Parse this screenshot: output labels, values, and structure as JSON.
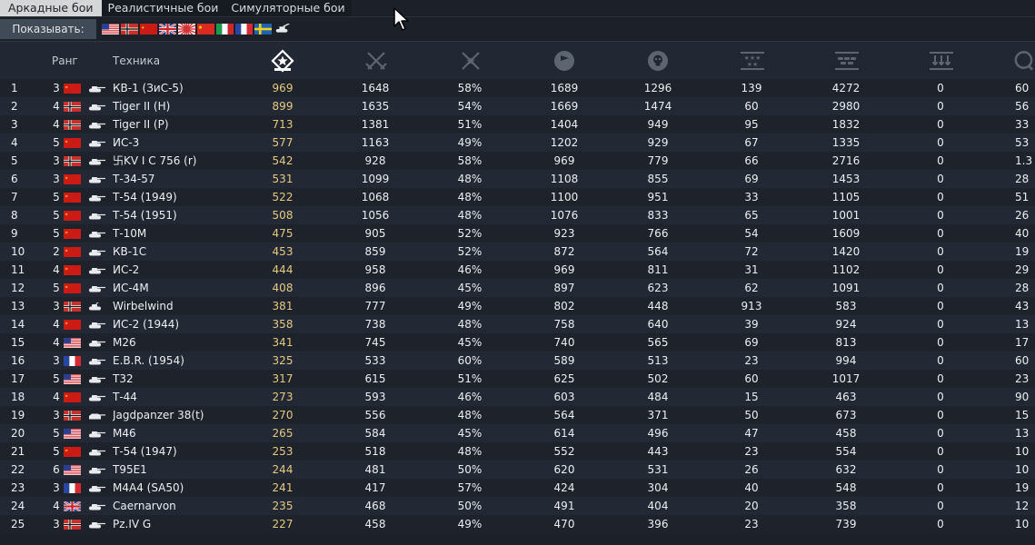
{
  "tabs": [
    {
      "label": "Аркадные бои",
      "active": true
    },
    {
      "label": "Реалистичные бои",
      "active": false
    },
    {
      "label": "Симуляторные бои",
      "active": false
    }
  ],
  "filter": {
    "show_label": "Показывать:",
    "nations": [
      "usa",
      "germany",
      "ussr",
      "britain",
      "japan",
      "china",
      "italy",
      "france",
      "sweden"
    ]
  },
  "columns": {
    "rank": "Ранг",
    "vehicle": "Техника",
    "icons": [
      "score-icon",
      "battles-icon",
      "winrate-icon",
      "respawns-icon",
      "deaths-icon",
      "air-kills-icon",
      "ground-kills-icon",
      "naval-kills-icon",
      "kd-ratio-icon"
    ]
  },
  "colors": {
    "ussr": "#cc1a14",
    "usa": "#ffffff",
    "germany": "#c9302c",
    "britain": "#1f3f8c",
    "france": "#1f3f8c",
    "score": "#e6c980",
    "tab_active": "#d4d6d8"
  },
  "rows": [
    {
      "n": "1",
      "rank": "3",
      "nation": "ussr",
      "type": "heavy",
      "name": "КВ-1 (ЗиС-5)",
      "score": "969",
      "battles": "1648",
      "win": "58%",
      "respawns": "1689",
      "deaths": "1296",
      "air": "139",
      "ground": "4272",
      "naval": "0",
      "last": "60"
    },
    {
      "n": "2",
      "rank": "4",
      "nation": "germany",
      "type": "heavy",
      "name": "Tiger II (H)",
      "score": "899",
      "battles": "1635",
      "win": "54%",
      "respawns": "1669",
      "deaths": "1474",
      "air": "60",
      "ground": "2980",
      "naval": "0",
      "last": "56"
    },
    {
      "n": "3",
      "rank": "4",
      "nation": "germany",
      "type": "heavy",
      "name": "Tiger II (P)",
      "score": "713",
      "battles": "1381",
      "win": "51%",
      "respawns": "1404",
      "deaths": "949",
      "air": "95",
      "ground": "1832",
      "naval": "0",
      "last": "33"
    },
    {
      "n": "4",
      "rank": "5",
      "nation": "ussr",
      "type": "heavy",
      "name": "ИС-3",
      "score": "577",
      "battles": "1163",
      "win": "49%",
      "respawns": "1202",
      "deaths": "929",
      "air": "67",
      "ground": "1335",
      "naval": "0",
      "last": "53"
    },
    {
      "n": "5",
      "rank": "3",
      "nation": "germany",
      "type": "heavy",
      "name": "卐KV I C 756 (r)",
      "score": "542",
      "battles": "928",
      "win": "58%",
      "respawns": "969",
      "deaths": "779",
      "air": "66",
      "ground": "2716",
      "naval": "0",
      "last": "1.3"
    },
    {
      "n": "6",
      "rank": "3",
      "nation": "ussr",
      "type": "medium",
      "name": "Т-34-57",
      "score": "531",
      "battles": "1099",
      "win": "48%",
      "respawns": "1108",
      "deaths": "855",
      "air": "69",
      "ground": "1453",
      "naval": "0",
      "last": "28"
    },
    {
      "n": "7",
      "rank": "5",
      "nation": "ussr",
      "type": "medium",
      "name": "Т-54 (1949)",
      "score": "522",
      "battles": "1068",
      "win": "48%",
      "respawns": "1100",
      "deaths": "951",
      "air": "33",
      "ground": "1105",
      "naval": "0",
      "last": "51"
    },
    {
      "n": "8",
      "rank": "5",
      "nation": "ussr",
      "type": "medium",
      "name": "Т-54 (1951)",
      "score": "508",
      "battles": "1056",
      "win": "48%",
      "respawns": "1076",
      "deaths": "833",
      "air": "65",
      "ground": "1001",
      "naval": "0",
      "last": "26"
    },
    {
      "n": "9",
      "rank": "5",
      "nation": "ussr",
      "type": "heavy",
      "name": "Т-10М",
      "score": "475",
      "battles": "905",
      "win": "52%",
      "respawns": "923",
      "deaths": "766",
      "air": "54",
      "ground": "1609",
      "naval": "0",
      "last": "40"
    },
    {
      "n": "10",
      "rank": "2",
      "nation": "ussr",
      "type": "heavy",
      "name": "КВ-1С",
      "score": "453",
      "battles": "859",
      "win": "52%",
      "respawns": "872",
      "deaths": "564",
      "air": "72",
      "ground": "1420",
      "naval": "0",
      "last": "19"
    },
    {
      "n": "11",
      "rank": "4",
      "nation": "ussr",
      "type": "heavy",
      "name": "ИС-2",
      "score": "444",
      "battles": "958",
      "win": "46%",
      "respawns": "969",
      "deaths": "811",
      "air": "31",
      "ground": "1102",
      "naval": "0",
      "last": "29"
    },
    {
      "n": "12",
      "rank": "5",
      "nation": "ussr",
      "type": "heavy",
      "name": "ИС-4М",
      "score": "408",
      "battles": "896",
      "win": "45%",
      "respawns": "897",
      "deaths": "623",
      "air": "62",
      "ground": "1091",
      "naval": "0",
      "last": "28"
    },
    {
      "n": "13",
      "rank": "3",
      "nation": "germany",
      "type": "spaa",
      "name": "Wirbelwind",
      "score": "381",
      "battles": "777",
      "win": "49%",
      "respawns": "802",
      "deaths": "448",
      "air": "913",
      "ground": "583",
      "naval": "0",
      "last": "43"
    },
    {
      "n": "14",
      "rank": "4",
      "nation": "ussr",
      "type": "heavy",
      "name": "ИС-2 (1944)",
      "score": "358",
      "battles": "738",
      "win": "48%",
      "respawns": "758",
      "deaths": "640",
      "air": "39",
      "ground": "924",
      "naval": "0",
      "last": "13"
    },
    {
      "n": "15",
      "rank": "4",
      "nation": "usa",
      "type": "heavy",
      "name": "M26",
      "score": "341",
      "battles": "745",
      "win": "45%",
      "respawns": "740",
      "deaths": "565",
      "air": "69",
      "ground": "813",
      "naval": "0",
      "last": "17"
    },
    {
      "n": "16",
      "rank": "3",
      "nation": "france",
      "type": "light",
      "name": "E.B.R. (1954)",
      "score": "325",
      "battles": "533",
      "win": "60%",
      "respawns": "589",
      "deaths": "513",
      "air": "23",
      "ground": "994",
      "naval": "0",
      "last": "60"
    },
    {
      "n": "17",
      "rank": "5",
      "nation": "usa",
      "type": "heavy",
      "name": "T32",
      "score": "317",
      "battles": "615",
      "win": "51%",
      "respawns": "625",
      "deaths": "502",
      "air": "60",
      "ground": "1017",
      "naval": "0",
      "last": "23"
    },
    {
      "n": "18",
      "rank": "4",
      "nation": "ussr",
      "type": "medium",
      "name": "Т-44",
      "score": "273",
      "battles": "593",
      "win": "46%",
      "respawns": "603",
      "deaths": "484",
      "air": "15",
      "ground": "463",
      "naval": "0",
      "last": "90"
    },
    {
      "n": "19",
      "rank": "3",
      "nation": "germany",
      "type": "destroyer",
      "name": "Jagdpanzer 38(t)",
      "score": "270",
      "battles": "556",
      "win": "48%",
      "respawns": "564",
      "deaths": "371",
      "air": "50",
      "ground": "673",
      "naval": "0",
      "last": "15"
    },
    {
      "n": "20",
      "rank": "5",
      "nation": "usa",
      "type": "medium",
      "name": "M46",
      "score": "265",
      "battles": "584",
      "win": "45%",
      "respawns": "614",
      "deaths": "496",
      "air": "47",
      "ground": "458",
      "naval": "0",
      "last": "13"
    },
    {
      "n": "21",
      "rank": "5",
      "nation": "ussr",
      "type": "medium",
      "name": "Т-54 (1947)",
      "score": "253",
      "battles": "518",
      "win": "48%",
      "respawns": "552",
      "deaths": "443",
      "air": "23",
      "ground": "554",
      "naval": "0",
      "last": "10"
    },
    {
      "n": "22",
      "rank": "6",
      "nation": "usa",
      "type": "heavy",
      "name": "T95E1",
      "score": "244",
      "battles": "481",
      "win": "50%",
      "respawns": "620",
      "deaths": "531",
      "air": "26",
      "ground": "632",
      "naval": "0",
      "last": "10"
    },
    {
      "n": "23",
      "rank": "3",
      "nation": "france",
      "type": "medium",
      "name": "M4A4 (SA50)",
      "score": "241",
      "battles": "417",
      "win": "57%",
      "respawns": "424",
      "deaths": "304",
      "air": "40",
      "ground": "548",
      "naval": "0",
      "last": "19"
    },
    {
      "n": "24",
      "rank": "4",
      "nation": "britain",
      "type": "heavy",
      "name": "Caernarvon",
      "score": "235",
      "battles": "468",
      "win": "50%",
      "respawns": "491",
      "deaths": "404",
      "air": "20",
      "ground": "358",
      "naval": "0",
      "last": "12"
    },
    {
      "n": "25",
      "rank": "3",
      "nation": "germany",
      "type": "medium",
      "name": "Pz.IV G",
      "score": "227",
      "battles": "458",
      "win": "49%",
      "respawns": "470",
      "deaths": "396",
      "air": "23",
      "ground": "739",
      "naval": "0",
      "last": "10"
    }
  ]
}
